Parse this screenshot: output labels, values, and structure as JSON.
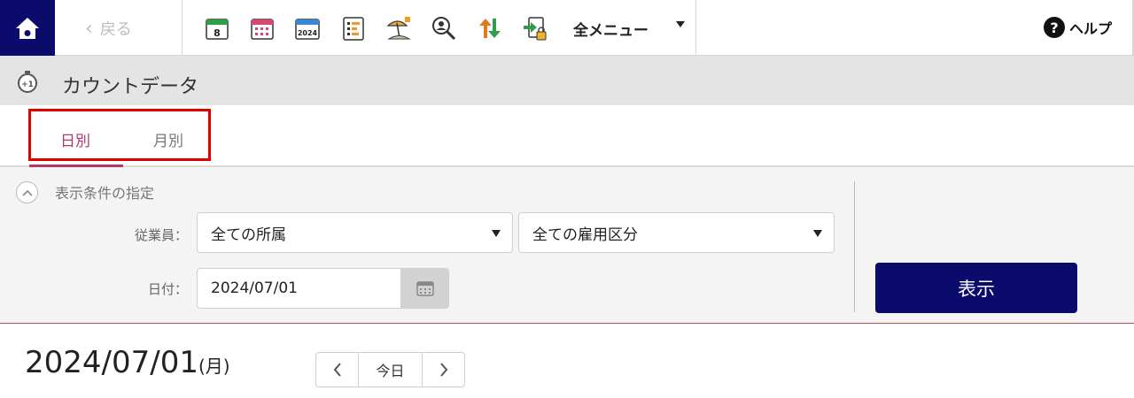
{
  "header": {
    "back_label": "戻る",
    "all_menu_label": "全メニュー",
    "help_label": "ヘルプ",
    "calendar_day_number": "8",
    "calendar_year_label": "2024",
    "toolbar_icons": [
      "daily-calendar-icon",
      "monthly-calendar-icon",
      "yearly-calendar-icon",
      "schedule-chart-icon",
      "vacation-icon",
      "search-person-icon",
      "sort-arrows-icon",
      "lock-exit-icon"
    ]
  },
  "page": {
    "title": "カウントデータ"
  },
  "tabs": [
    {
      "label": "日別",
      "active": true
    },
    {
      "label": "月別",
      "active": false
    }
  ],
  "filter": {
    "section_title": "表示条件の指定",
    "employee_label": "従業員：",
    "department_select": "全ての所属",
    "employment_type_select": "全ての雇用区分",
    "date_label": "日付：",
    "date_value": "2024/07/01",
    "show_button": "表示"
  },
  "date_nav": {
    "date": "2024/07/01",
    "day_of_week": "(月)",
    "today_label": "今日"
  },
  "colors": {
    "brand_navy": "#0b0b6b",
    "active_tab": "#b0386f",
    "highlight_red": "#e10000"
  }
}
